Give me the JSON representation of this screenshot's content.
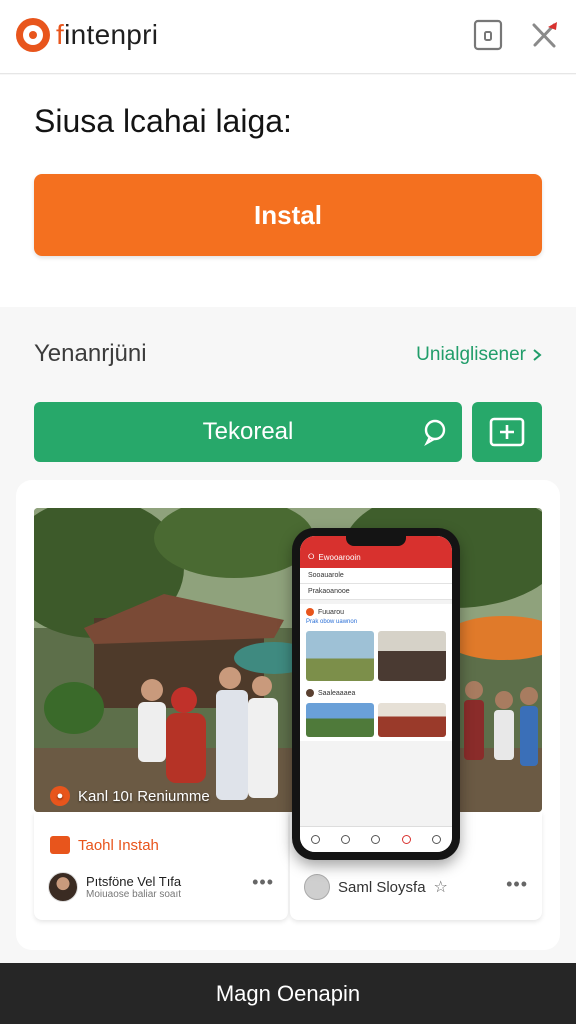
{
  "app": {
    "logo_text_a": "f",
    "logo_text_b": "intenpri",
    "brand_color": "#e8551c"
  },
  "header": {
    "device_icon": "device-icon",
    "close_icon": "close-x-icon"
  },
  "hero": {
    "title": "Siusa lcahai laiga:",
    "install_label": "Instal",
    "install_color": "#f4701f"
  },
  "section": {
    "title": "Yenanrjüni",
    "link_label": "Unialglisener"
  },
  "actions": {
    "primary_label": "Tekoreal",
    "accent_color": "#27a86a"
  },
  "photo": {
    "caption": "Kanl 10ı Reniumme"
  },
  "card_left": {
    "tag_label": "Taohl Instah",
    "user_name": "Pıtsföne Vel Tıfa",
    "user_sub": "Moiuaose baliar soaıt"
  },
  "card_right": {
    "user_name": "Saml Sloysfa"
  },
  "phone_screen": {
    "top_label": "Ewooarooin",
    "row1": "Sooauarole",
    "row2": "Prakaoanooe",
    "block_title": "Fuuarou",
    "block_link": "Prak obow uawnon",
    "user_row": "Saaleaaaea"
  },
  "bottom": {
    "label": "Magn Oenapin"
  }
}
